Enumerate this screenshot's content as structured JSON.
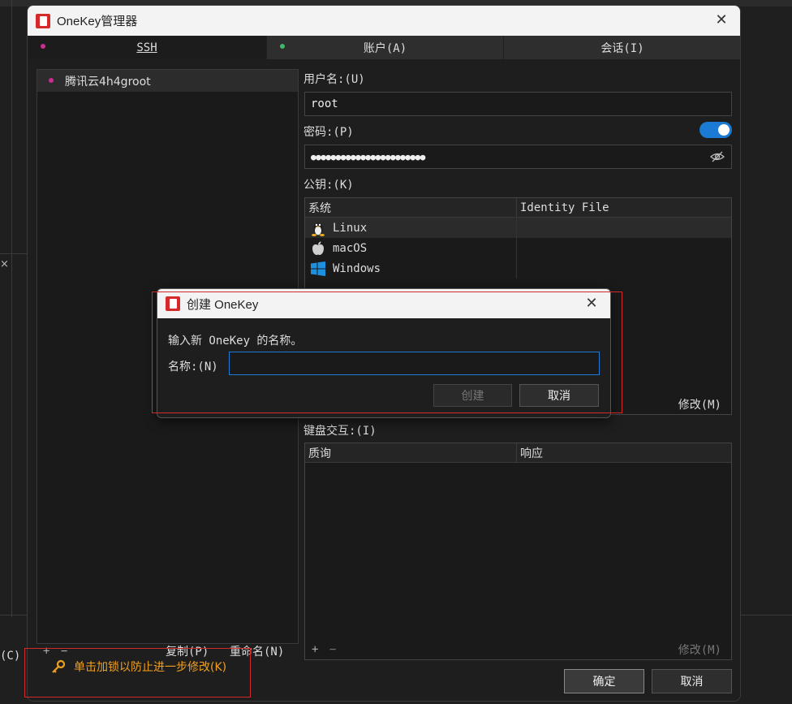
{
  "background": {
    "close_glyph": "×",
    "menu_hint": "(C)"
  },
  "window": {
    "title": "OneKey管理器",
    "close": "✕"
  },
  "tabs": [
    {
      "label": "SSH",
      "dot_color": "#cc2d94",
      "active": true
    },
    {
      "label": "账户(A)",
      "dot_color": "#3fb86a",
      "active": false
    },
    {
      "label": "会话(I)",
      "dot_color": "",
      "active": false
    }
  ],
  "list": {
    "items": [
      {
        "label": "腾讯云4h4groot",
        "dot_color": "#cc2d94"
      }
    ],
    "toolbar": {
      "add": "+",
      "remove": "−",
      "copy": "复制(P)",
      "rename": "重命名(N)"
    }
  },
  "form": {
    "username_label": "用户名:(U)",
    "username_value": "root",
    "password_label": "密码:(P)",
    "password_value": "●●●●●●●●●●●●●●●●●●●●●●●",
    "password_toggle_on": true,
    "pubkey_label": "公钥:(K)",
    "pubkey_grid": {
      "headers": [
        "系统",
        "Identity File"
      ],
      "rows": [
        {
          "os": "Linux",
          "icon": "linux-icon",
          "file": ""
        },
        {
          "os": "macOS",
          "icon": "apple-icon",
          "file": ""
        },
        {
          "os": "Windows",
          "icon": "windows-icon",
          "file": ""
        }
      ],
      "modify": "修改(M)"
    },
    "kbd_label": "键盘交互:(I)",
    "kbd_grid": {
      "headers": [
        "质询",
        "响应"
      ],
      "add": "+",
      "remove": "−",
      "modify": "修改(M)"
    }
  },
  "footer": {
    "lock_hint": "单击加锁以防止进一步修改(K)",
    "ok": "确定",
    "cancel": "取消"
  },
  "dialog": {
    "title": "创建 OneKey",
    "close": "✕",
    "prompt": "输入新 OneKey 的名称。",
    "name_label": "名称:(N)",
    "name_value": "",
    "create": "创建",
    "cancel": "取消"
  },
  "colors": {
    "accent": "#1a7ad4",
    "warning": "#f0a020",
    "highlight_box": "#d12a2a"
  }
}
